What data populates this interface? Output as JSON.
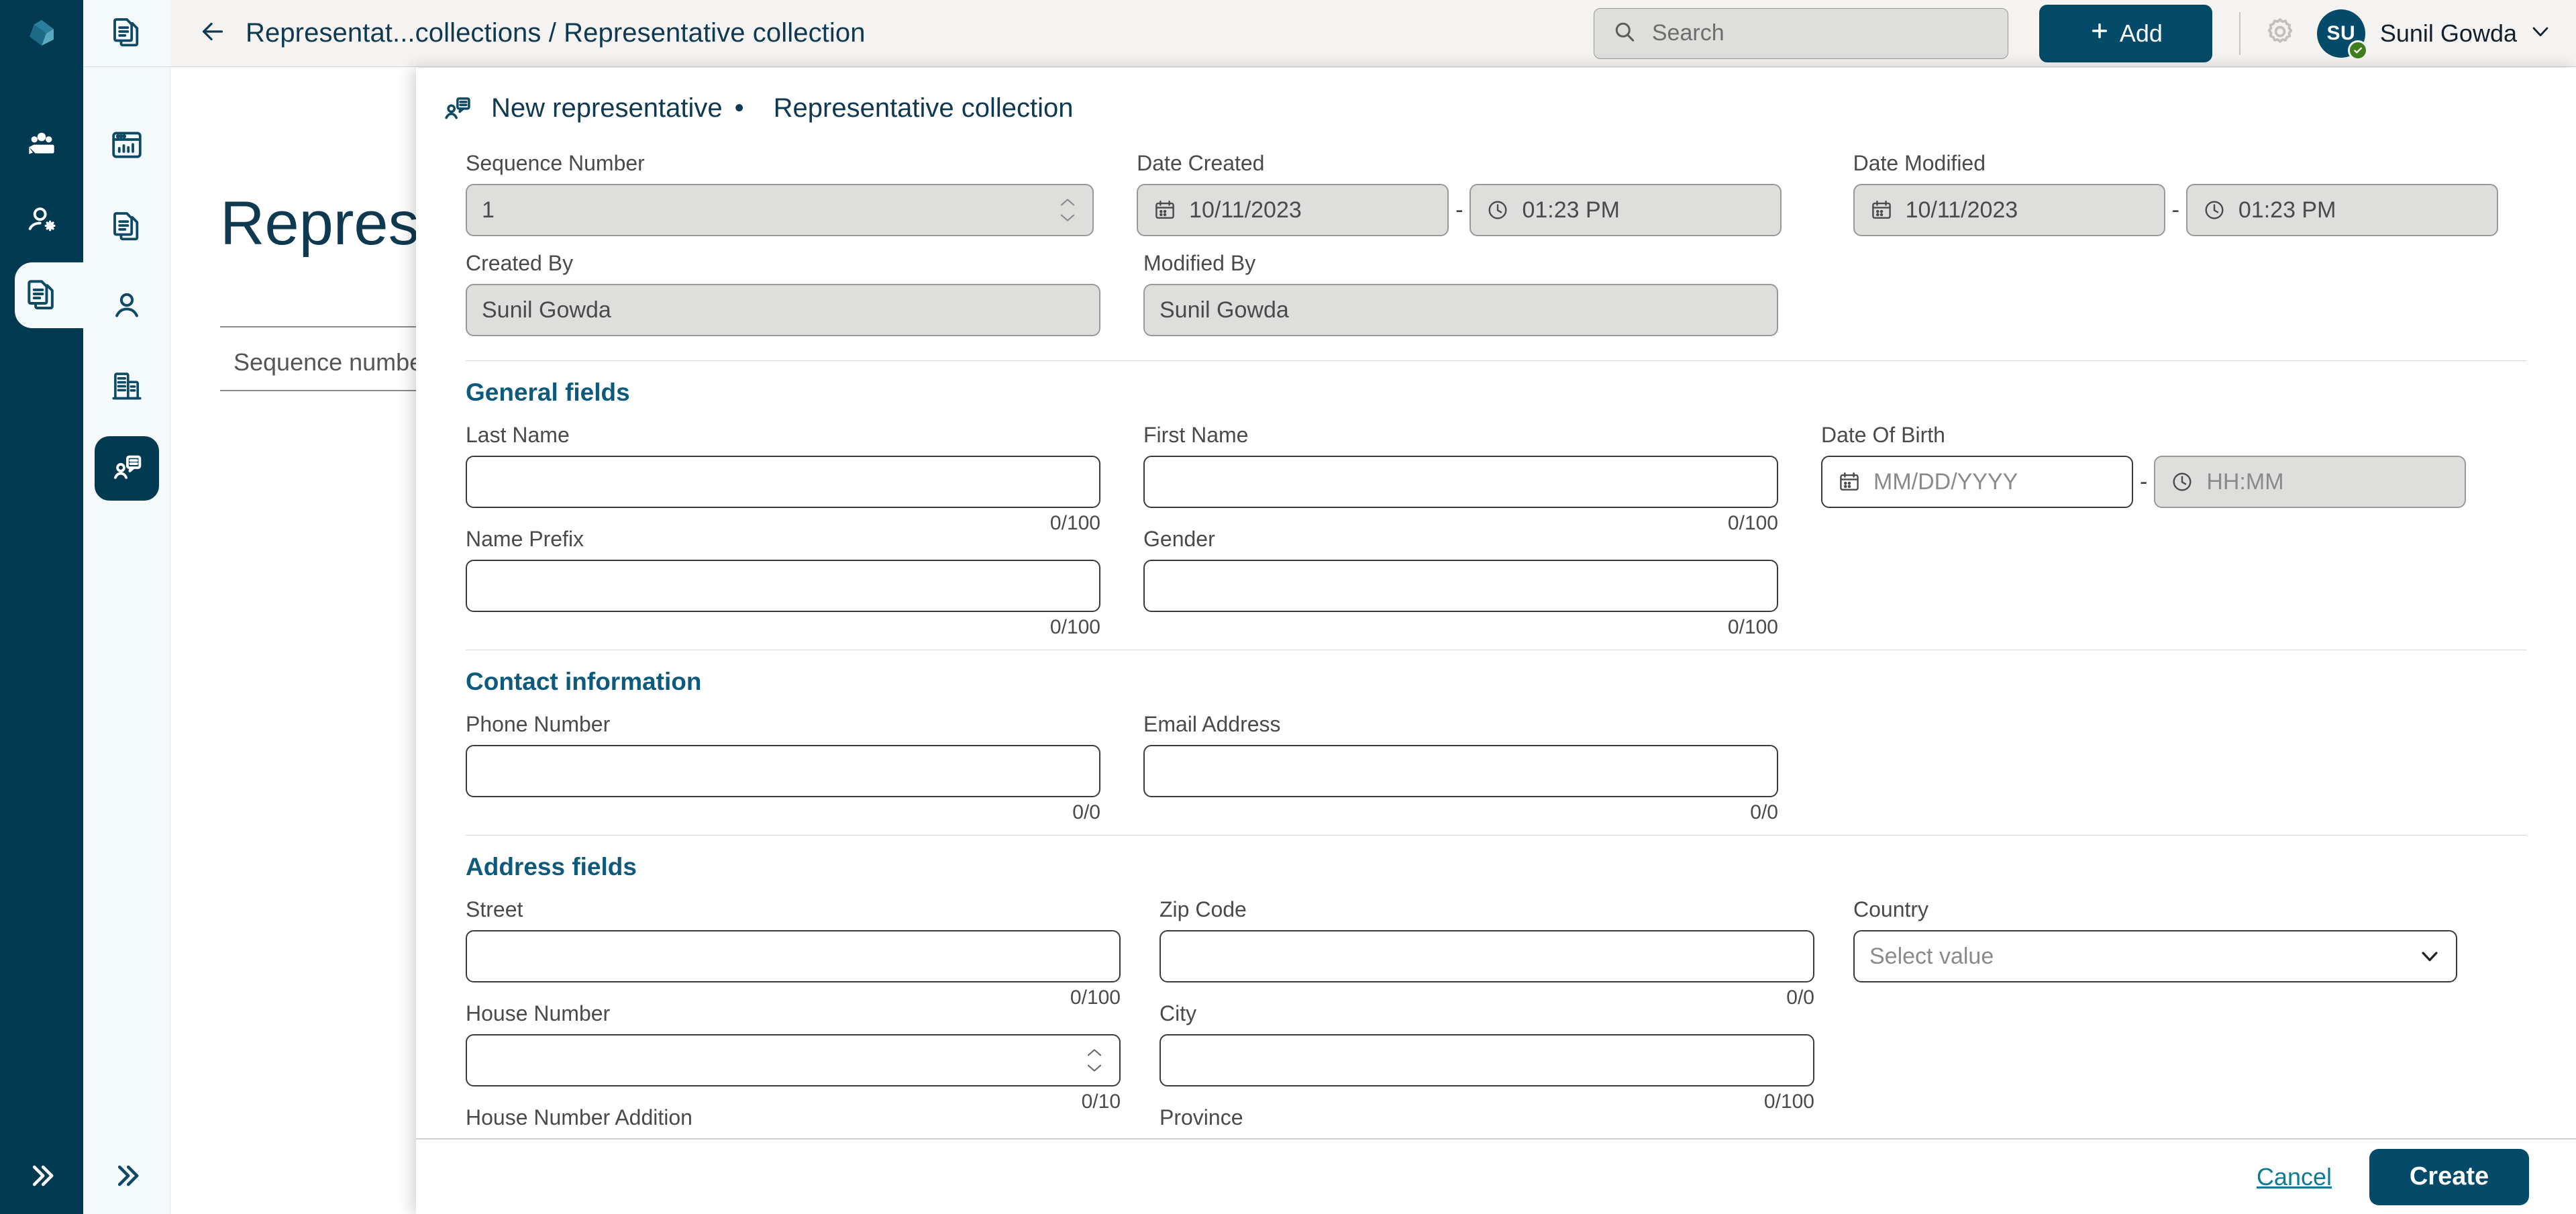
{
  "brand": {
    "accent": "#034b68",
    "accent_dark": "#013a51",
    "link": "#0d7b94",
    "section_heading": "#0e5a7d"
  },
  "topbar": {
    "breadcrumb": "Representat...collections / Representative collection",
    "back_icon": "arrow-left-icon",
    "search": {
      "placeholder": "Search",
      "icon": "search-icon"
    },
    "add_button": {
      "label": "Add",
      "icon": "plus-icon"
    },
    "settings_icon": "gear-icon",
    "user": {
      "initials": "SU",
      "name": "Sunil Gowda",
      "status": "online",
      "caret": "chevron-down-icon"
    }
  },
  "rail_primary": {
    "logo_icon": "app-logo-icon",
    "items": [
      {
        "name": "teams-icon",
        "label": "Teams"
      },
      {
        "name": "user-settings-icon",
        "label": "User settings"
      },
      {
        "name": "documents-icon",
        "label": "Documents",
        "active": true
      }
    ],
    "expand_icon": "chevrons-right-icon"
  },
  "rail_secondary": {
    "top_icon": "documents-icon",
    "items": [
      {
        "name": "dashboard-icon",
        "label": "Dashboard"
      },
      {
        "name": "documents-icon",
        "label": "Documents"
      },
      {
        "name": "person-icon",
        "label": "Persons"
      },
      {
        "name": "organization-icon",
        "label": "Organizations"
      },
      {
        "name": "representative-icon",
        "label": "Representatives",
        "active": true
      }
    ],
    "expand_icon": "chevrons-right-icon"
  },
  "background_page": {
    "title": "Represen",
    "column_header": "Sequence number"
  },
  "modal": {
    "icon": "representative-icon",
    "title": "New representative",
    "separator": "•",
    "subtitle": "Representative collection",
    "meta": {
      "sequence_number": {
        "label": "Sequence Number",
        "value": "1",
        "disabled": true
      },
      "date_created": {
        "label": "Date Created",
        "date": "10/11/2023",
        "time": "01:23 PM",
        "date_icon": "calendar-icon",
        "time_icon": "clock-icon",
        "separator": "-",
        "disabled": true
      },
      "date_modified": {
        "label": "Date Modified",
        "date": "10/11/2023",
        "time": "01:23 PM",
        "date_icon": "calendar-icon",
        "time_icon": "clock-icon",
        "separator": "-",
        "disabled": true
      },
      "created_by": {
        "label": "Created By",
        "value": "Sunil  Gowda",
        "disabled": true
      },
      "modified_by": {
        "label": "Modified By",
        "value": "Sunil  Gowda",
        "disabled": true
      }
    },
    "sections": [
      {
        "heading": "General fields",
        "fields": {
          "last_name": {
            "label": "Last Name",
            "value": "",
            "counter": "0/100"
          },
          "first_name": {
            "label": "First Name",
            "value": "",
            "counter": "0/100"
          },
          "date_of_birth": {
            "label": "Date Of Birth",
            "date_placeholder": "MM/DD/YYYY",
            "time_placeholder": "HH:MM",
            "date_icon": "calendar-icon",
            "time_icon": "clock-icon",
            "separator": "-",
            "time_disabled": true
          },
          "name_prefix": {
            "label": "Name Prefix",
            "value": "",
            "counter": "0/100"
          },
          "gender": {
            "label": "Gender",
            "value": "",
            "counter": "0/100"
          }
        }
      },
      {
        "heading": "Contact information",
        "fields": {
          "phone_number": {
            "label": "Phone Number",
            "value": "",
            "counter": "0/0"
          },
          "email_address": {
            "label": "Email Address",
            "value": "",
            "counter": "0/0"
          }
        }
      },
      {
        "heading": "Address fields",
        "fields": {
          "street": {
            "label": "Street",
            "value": "",
            "counter": "0/100"
          },
          "zip_code": {
            "label": "Zip Code",
            "value": "",
            "counter": "0/0"
          },
          "country": {
            "label": "Country",
            "placeholder": "Select value",
            "caret": "chevron-down-icon"
          },
          "house_number": {
            "label": "House Number",
            "value": "",
            "counter": "0/10",
            "stepper": true
          },
          "city": {
            "label": "City",
            "value": "",
            "counter": "0/100"
          },
          "house_number_addition": {
            "label": "House Number Addition",
            "value": ""
          },
          "province": {
            "label": "Province",
            "value": ""
          }
        }
      }
    ],
    "footer": {
      "cancel_label": "Cancel",
      "create_label": "Create"
    }
  }
}
